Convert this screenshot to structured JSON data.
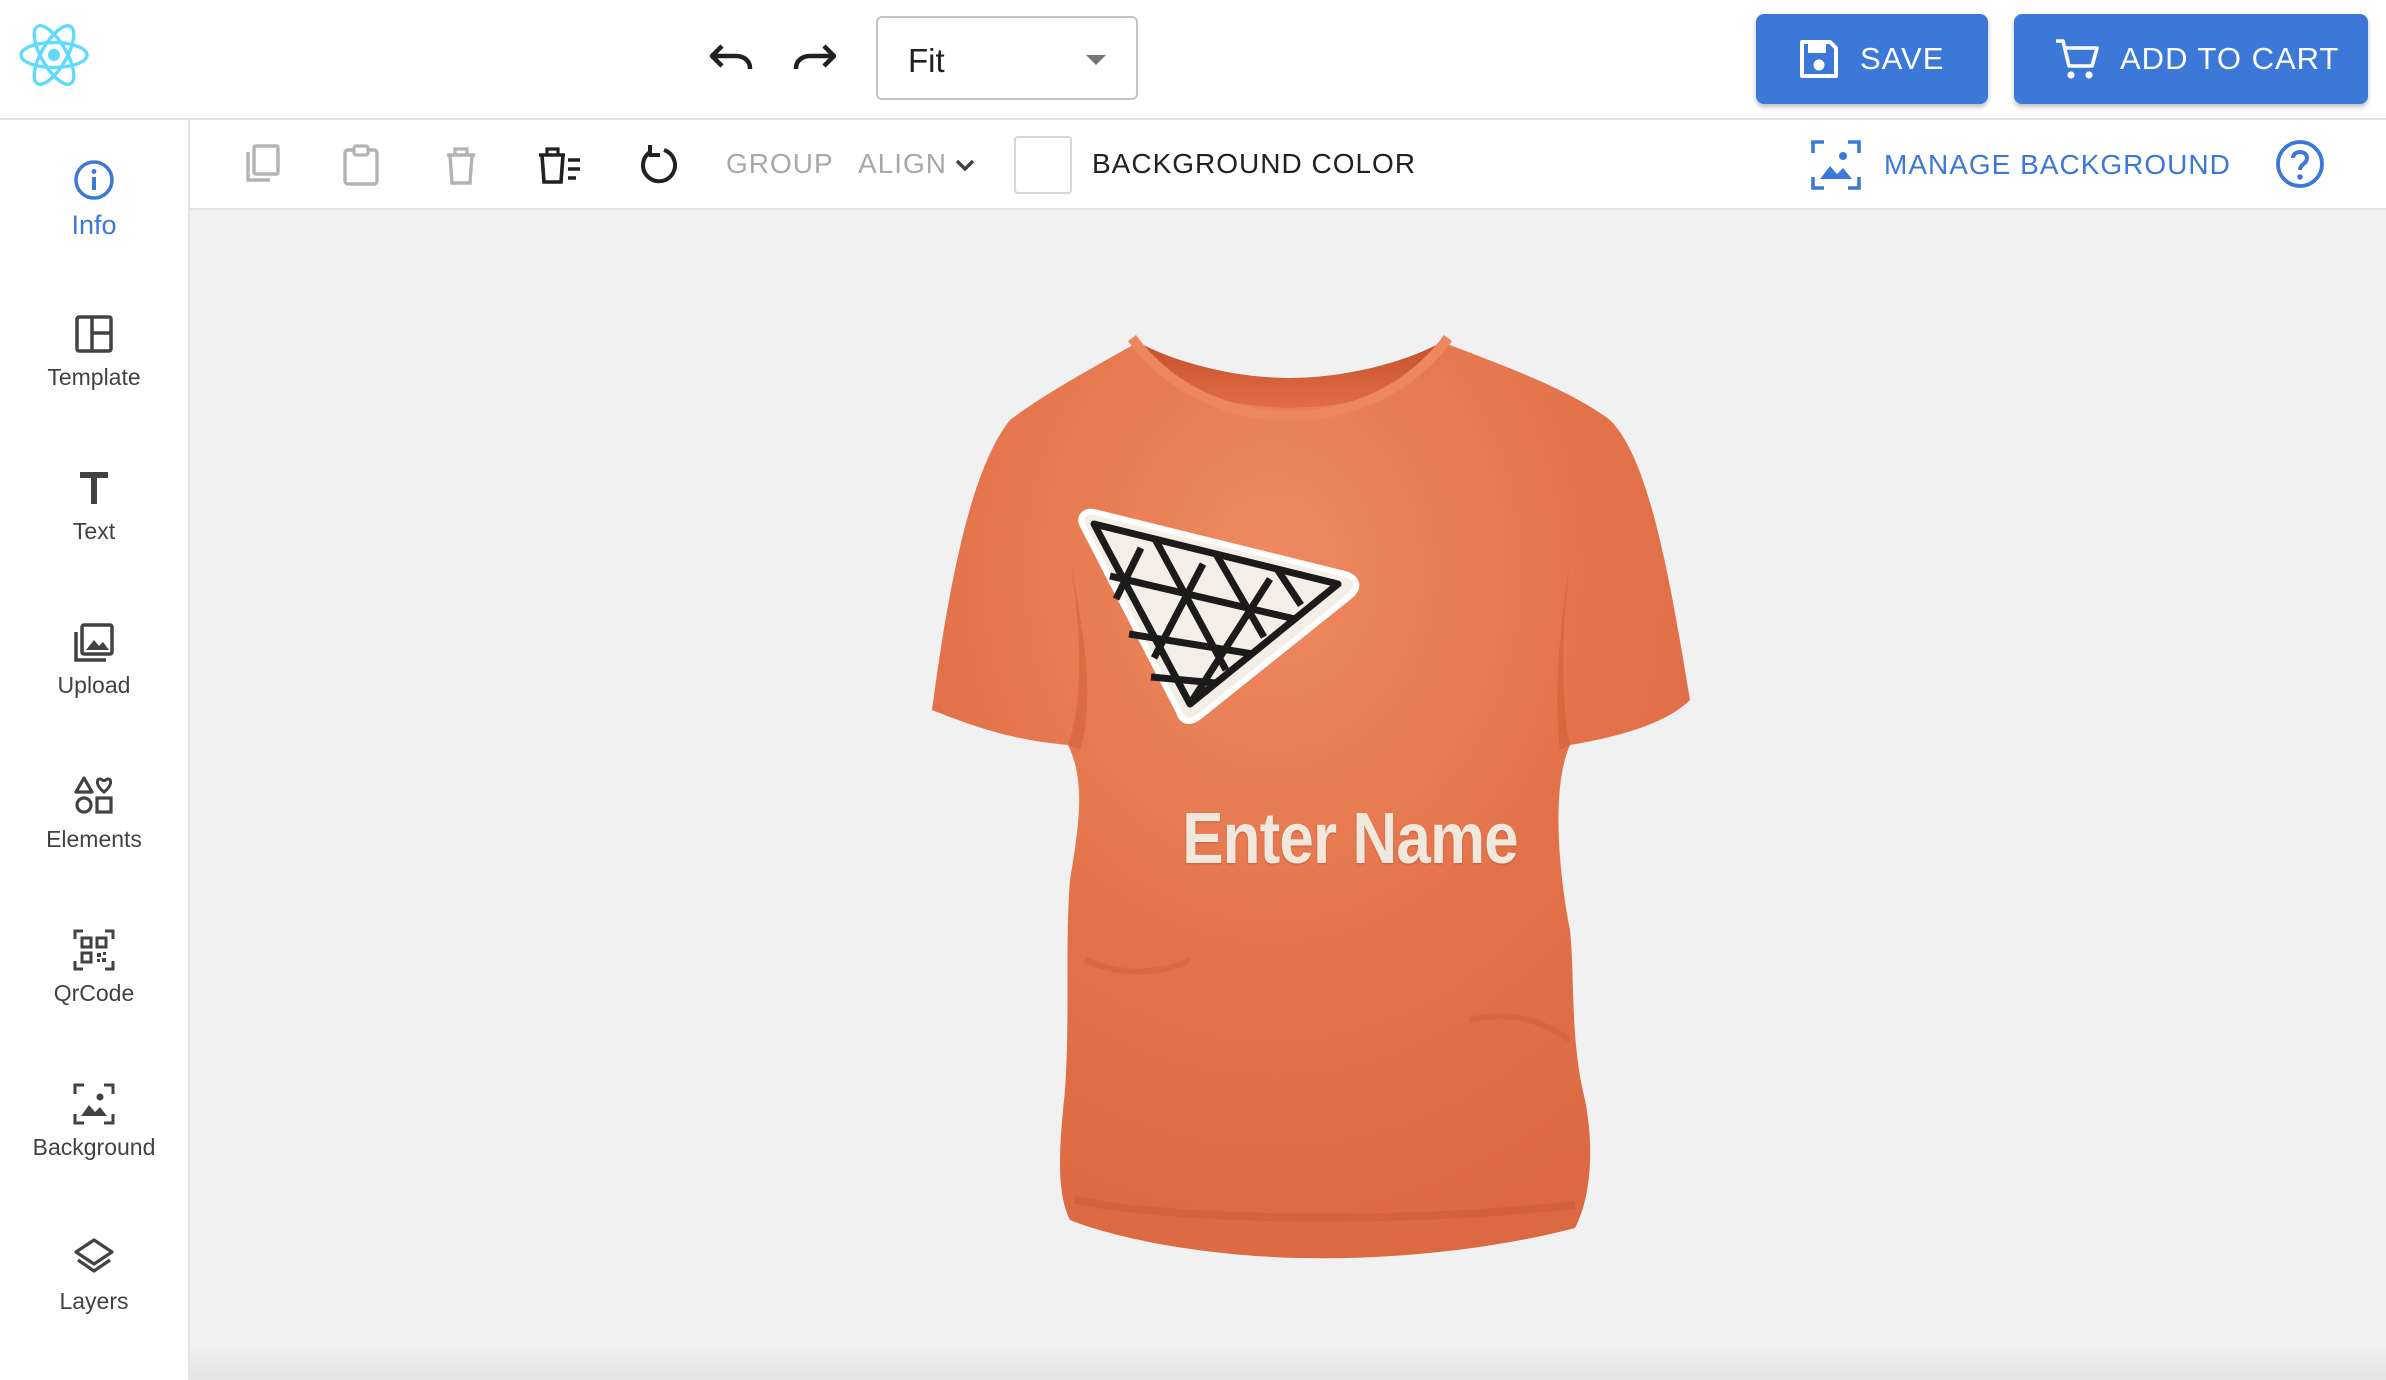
{
  "header": {
    "zoom": {
      "value": "Fit"
    },
    "save_label": "SAVE",
    "cart_label": "ADD TO CART"
  },
  "sidebar": {
    "items": [
      {
        "label": "Info",
        "icon": "info-icon",
        "active": true
      },
      {
        "label": "Template",
        "icon": "template-icon"
      },
      {
        "label": "Text",
        "icon": "text-icon"
      },
      {
        "label": "Upload",
        "icon": "upload-icon"
      },
      {
        "label": "Elements",
        "icon": "elements-icon"
      },
      {
        "label": "QrCode",
        "icon": "qrcode-icon"
      },
      {
        "label": "Background",
        "icon": "background-icon"
      },
      {
        "label": "Layers",
        "icon": "layers-icon"
      }
    ]
  },
  "toolbar": {
    "group_label": "GROUP",
    "align_label": "ALIGN",
    "bgcolor_label": "BACKGROUND COLOR",
    "bgcolor_value": "#ffffff",
    "manage_bg_label": "MANAGE BACKGROUND"
  },
  "canvas": {
    "name_text": "Enter Name",
    "shirt_color": "#e8744a"
  },
  "colors": {
    "accent": "#3b78d8",
    "react_logo": "#61dafb"
  }
}
